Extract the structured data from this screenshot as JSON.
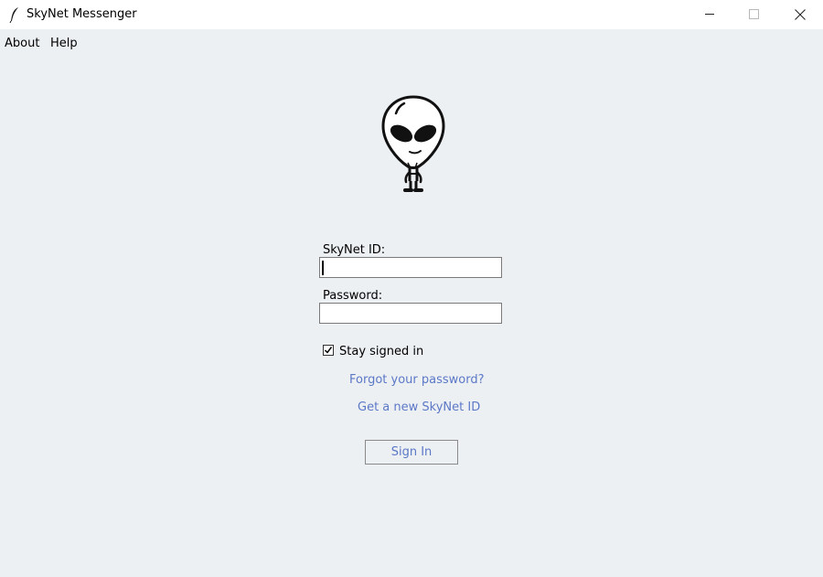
{
  "window": {
    "title": "SkyNet Messenger",
    "icon": "feather-icon",
    "controls": [
      "minimize-icon",
      "maximize-icon",
      "close-icon"
    ]
  },
  "menu": {
    "items": [
      {
        "label": "About"
      },
      {
        "label": "Help"
      }
    ]
  },
  "logo": {
    "icon": "alien-icon"
  },
  "form": {
    "id_label": "SkyNet ID:",
    "id_value": "",
    "password_label": "Password:",
    "password_value": "",
    "stay_signed_in_label": "Stay signed in",
    "stay_signed_in_checked": true,
    "forgot_link": "Forgot your password?",
    "new_id_link": "Get a new SkyNet ID",
    "sign_in_label": "Sign In"
  },
  "colors": {
    "background": "#edf0f3",
    "titlebar": "#ffffff",
    "link": "#5b78c7"
  }
}
